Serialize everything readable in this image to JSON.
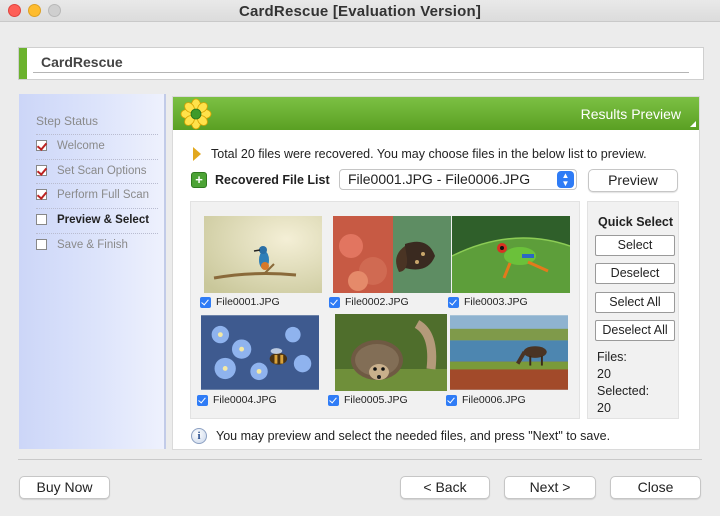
{
  "window": {
    "title": "CardRescue [Evaluation Version]"
  },
  "header": {
    "app_name": "CardRescue"
  },
  "sidebar": {
    "title": "Step Status",
    "steps": [
      {
        "label": "Welcome",
        "checked": true
      },
      {
        "label": "Set Scan Options",
        "checked": true
      },
      {
        "label": "Perform Full Scan",
        "checked": true
      },
      {
        "label": "Preview & Select",
        "checked": false,
        "active": true
      },
      {
        "label": "Save & Finish",
        "checked": false
      }
    ]
  },
  "panel": {
    "title": "Results Preview",
    "info": "Total 20 files were recovered. You may choose files in the below list to preview.",
    "list_label": "Recovered File List",
    "range_select": "File0001.JPG - File0006.JPG",
    "preview_button": "Preview",
    "hint": "You may preview and select the needed files, and press \"Next\" to save."
  },
  "files": [
    {
      "name": "File0001.JPG",
      "checked": true,
      "icon": "kingfisher-photo"
    },
    {
      "name": "File0002.JPG",
      "checked": true,
      "icon": "butterfly-photo"
    },
    {
      "name": "File0003.JPG",
      "checked": true,
      "icon": "tree-frog-photo"
    },
    {
      "name": "File0004.JPG",
      "checked": true,
      "icon": "forget-me-not-bee-photo"
    },
    {
      "name": "File0005.JPG",
      "checked": true,
      "icon": "hedgehog-photo"
    },
    {
      "name": "File0006.JPG",
      "checked": true,
      "icon": "horse-grazing-photo"
    }
  ],
  "quick_select": {
    "title": "Quick Select",
    "select": "Select",
    "deselect": "Deselect",
    "select_all": "Select All",
    "deselect_all": "Deselect All",
    "files_label": "Files:",
    "files_count": "20",
    "selected_label": "Selected:",
    "selected_count": "20"
  },
  "footer": {
    "buy_now": "Buy Now",
    "back": "< Back",
    "next": "Next >",
    "close": "Close"
  },
  "colors": {
    "accent_green": "#6bb22d",
    "checkbox_blue": "#2f7cf6",
    "sidebar_blue": "#ccd6f8"
  }
}
